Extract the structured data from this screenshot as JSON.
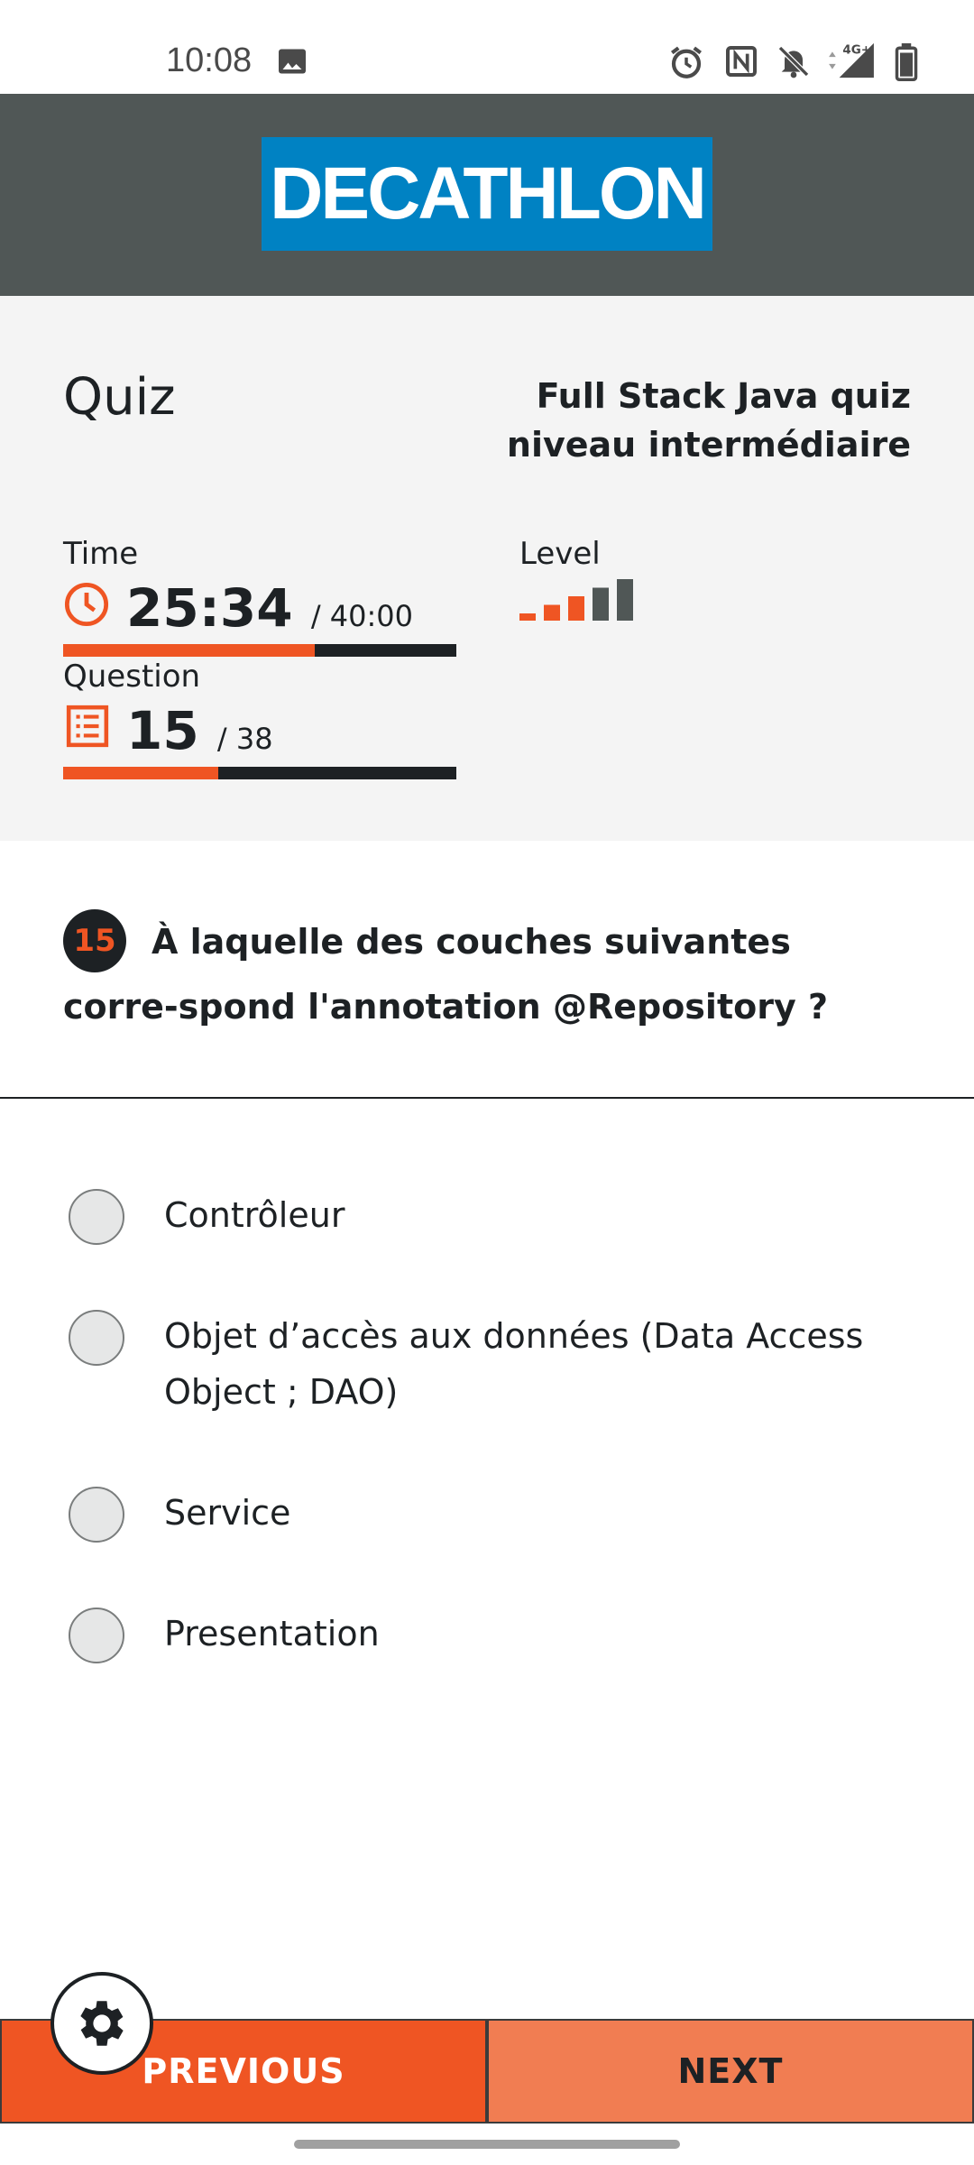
{
  "status_bar": {
    "time": "10:08",
    "icons": [
      "image-icon",
      "alarm-icon",
      "nfc-icon",
      "bell-off-icon",
      "signal-4g-icon",
      "battery-icon"
    ],
    "network_label": "4G+"
  },
  "header": {
    "logo_text": "DECATHLON",
    "logo_color": "#0082c3",
    "background": "#505756"
  },
  "quiz": {
    "title": "Quiz",
    "name": "Full Stack Java quiz niveau intermédiaire",
    "time_label": "Time",
    "time_value": "25:34",
    "time_total": "/ 40:00",
    "time_progress": 0.64,
    "question_label": "Question",
    "question_value": "15",
    "question_total": "/ 38",
    "question_progress": 0.395,
    "level_label": "Level",
    "level_value": 3,
    "level_max": 5
  },
  "question": {
    "number": "15",
    "text": "À laquelle des couches suivantes corre-spond l'annotation @Repository ?"
  },
  "options": [
    {
      "label": "Contrôleur"
    },
    {
      "label": "Objet d’accès aux données (Data Access Object ; DAO)"
    },
    {
      "label": "Service"
    },
    {
      "label": "Presentation"
    }
  ],
  "navigation": {
    "previous_label": "PREVIOUS",
    "next_label": "NEXT"
  },
  "colors": {
    "accent": "#ef5523",
    "accent_light": "#f17d52",
    "dark": "#1d2124"
  }
}
